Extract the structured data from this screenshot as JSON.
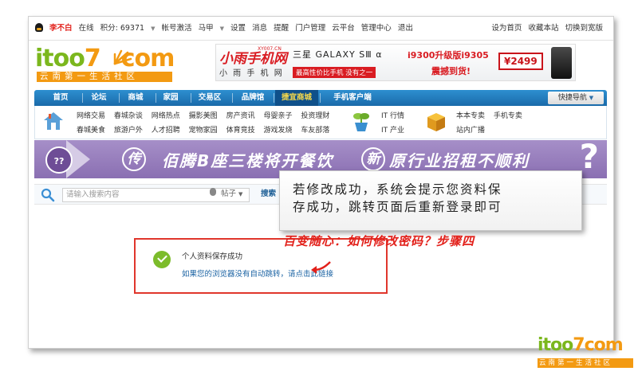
{
  "topbar": {
    "username": "李不白",
    "status": "在线",
    "points": "积分: 69371",
    "items": [
      "帐号激活",
      "马甲",
      "设置",
      "消息",
      "提醒",
      "门户管理",
      "云平台",
      "管理中心",
      "退出"
    ],
    "right_items": [
      "设为首页",
      "收藏本站",
      "切换到宽版"
    ]
  },
  "logo": {
    "part1": "itoo",
    "part2": "7",
    "part3": "com",
    "slogan": "云南第一生活社区"
  },
  "ad": {
    "brand": "小雨手机网",
    "site": "XY007.CN",
    "sub": "小 雨 手 机 网",
    "phone": "三星 GALAXY SⅢ α",
    "tag": "最高性价比手机 没有之一",
    "model": "i9300升级版i9305",
    "shock": "震撼到货!",
    "price": "¥2499"
  },
  "nav": {
    "items": [
      "首页",
      "论坛",
      "商城",
      "家园",
      "交易区",
      "品牌馆",
      "捷宜商城",
      "手机客户端"
    ],
    "quick": "快捷导航"
  },
  "sublinks": {
    "row1": [
      "网络交易",
      "春城杂谈",
      "网络热点",
      "摄影美图",
      "房产资讯",
      "母婴亲子",
      "投资理财"
    ],
    "row2": [
      "春城美食",
      "旅游户外",
      "人才招聘",
      "宠物家园",
      "体育竞技",
      "游戏发烧",
      "车友部落"
    ],
    "group2_row1": [
      "IT 行情"
    ],
    "group2_row2": [
      "IT 产业"
    ],
    "group3_row1": [
      "本本专卖",
      "手机专卖"
    ],
    "group3_row2": [
      "站内广播"
    ]
  },
  "purple_banner": {
    "badge": "??",
    "c1": "传",
    "text1": "佰腾B座三楼将开餐饮",
    "c2": "新",
    "text2": "原行业招租不顺利",
    "q": "?"
  },
  "search": {
    "placeholder": "请输入搜索内容",
    "scope": "帖子",
    "button": "搜索"
  },
  "notice": {
    "title": "个人资料保存成功",
    "link": "如果您的浏览器没有自动跳转，请点击此链接"
  },
  "tip": {
    "line1": "若修改成功，系统会提示您资料保",
    "line2": "存成功，跳转页面后重新登录即可"
  },
  "caption": "百变随心：如何修改密码？步骤四",
  "watermark": {
    "part1": "itoo",
    "part2": "7",
    "part3": "com",
    "slogan": "云南第一生活社区"
  }
}
